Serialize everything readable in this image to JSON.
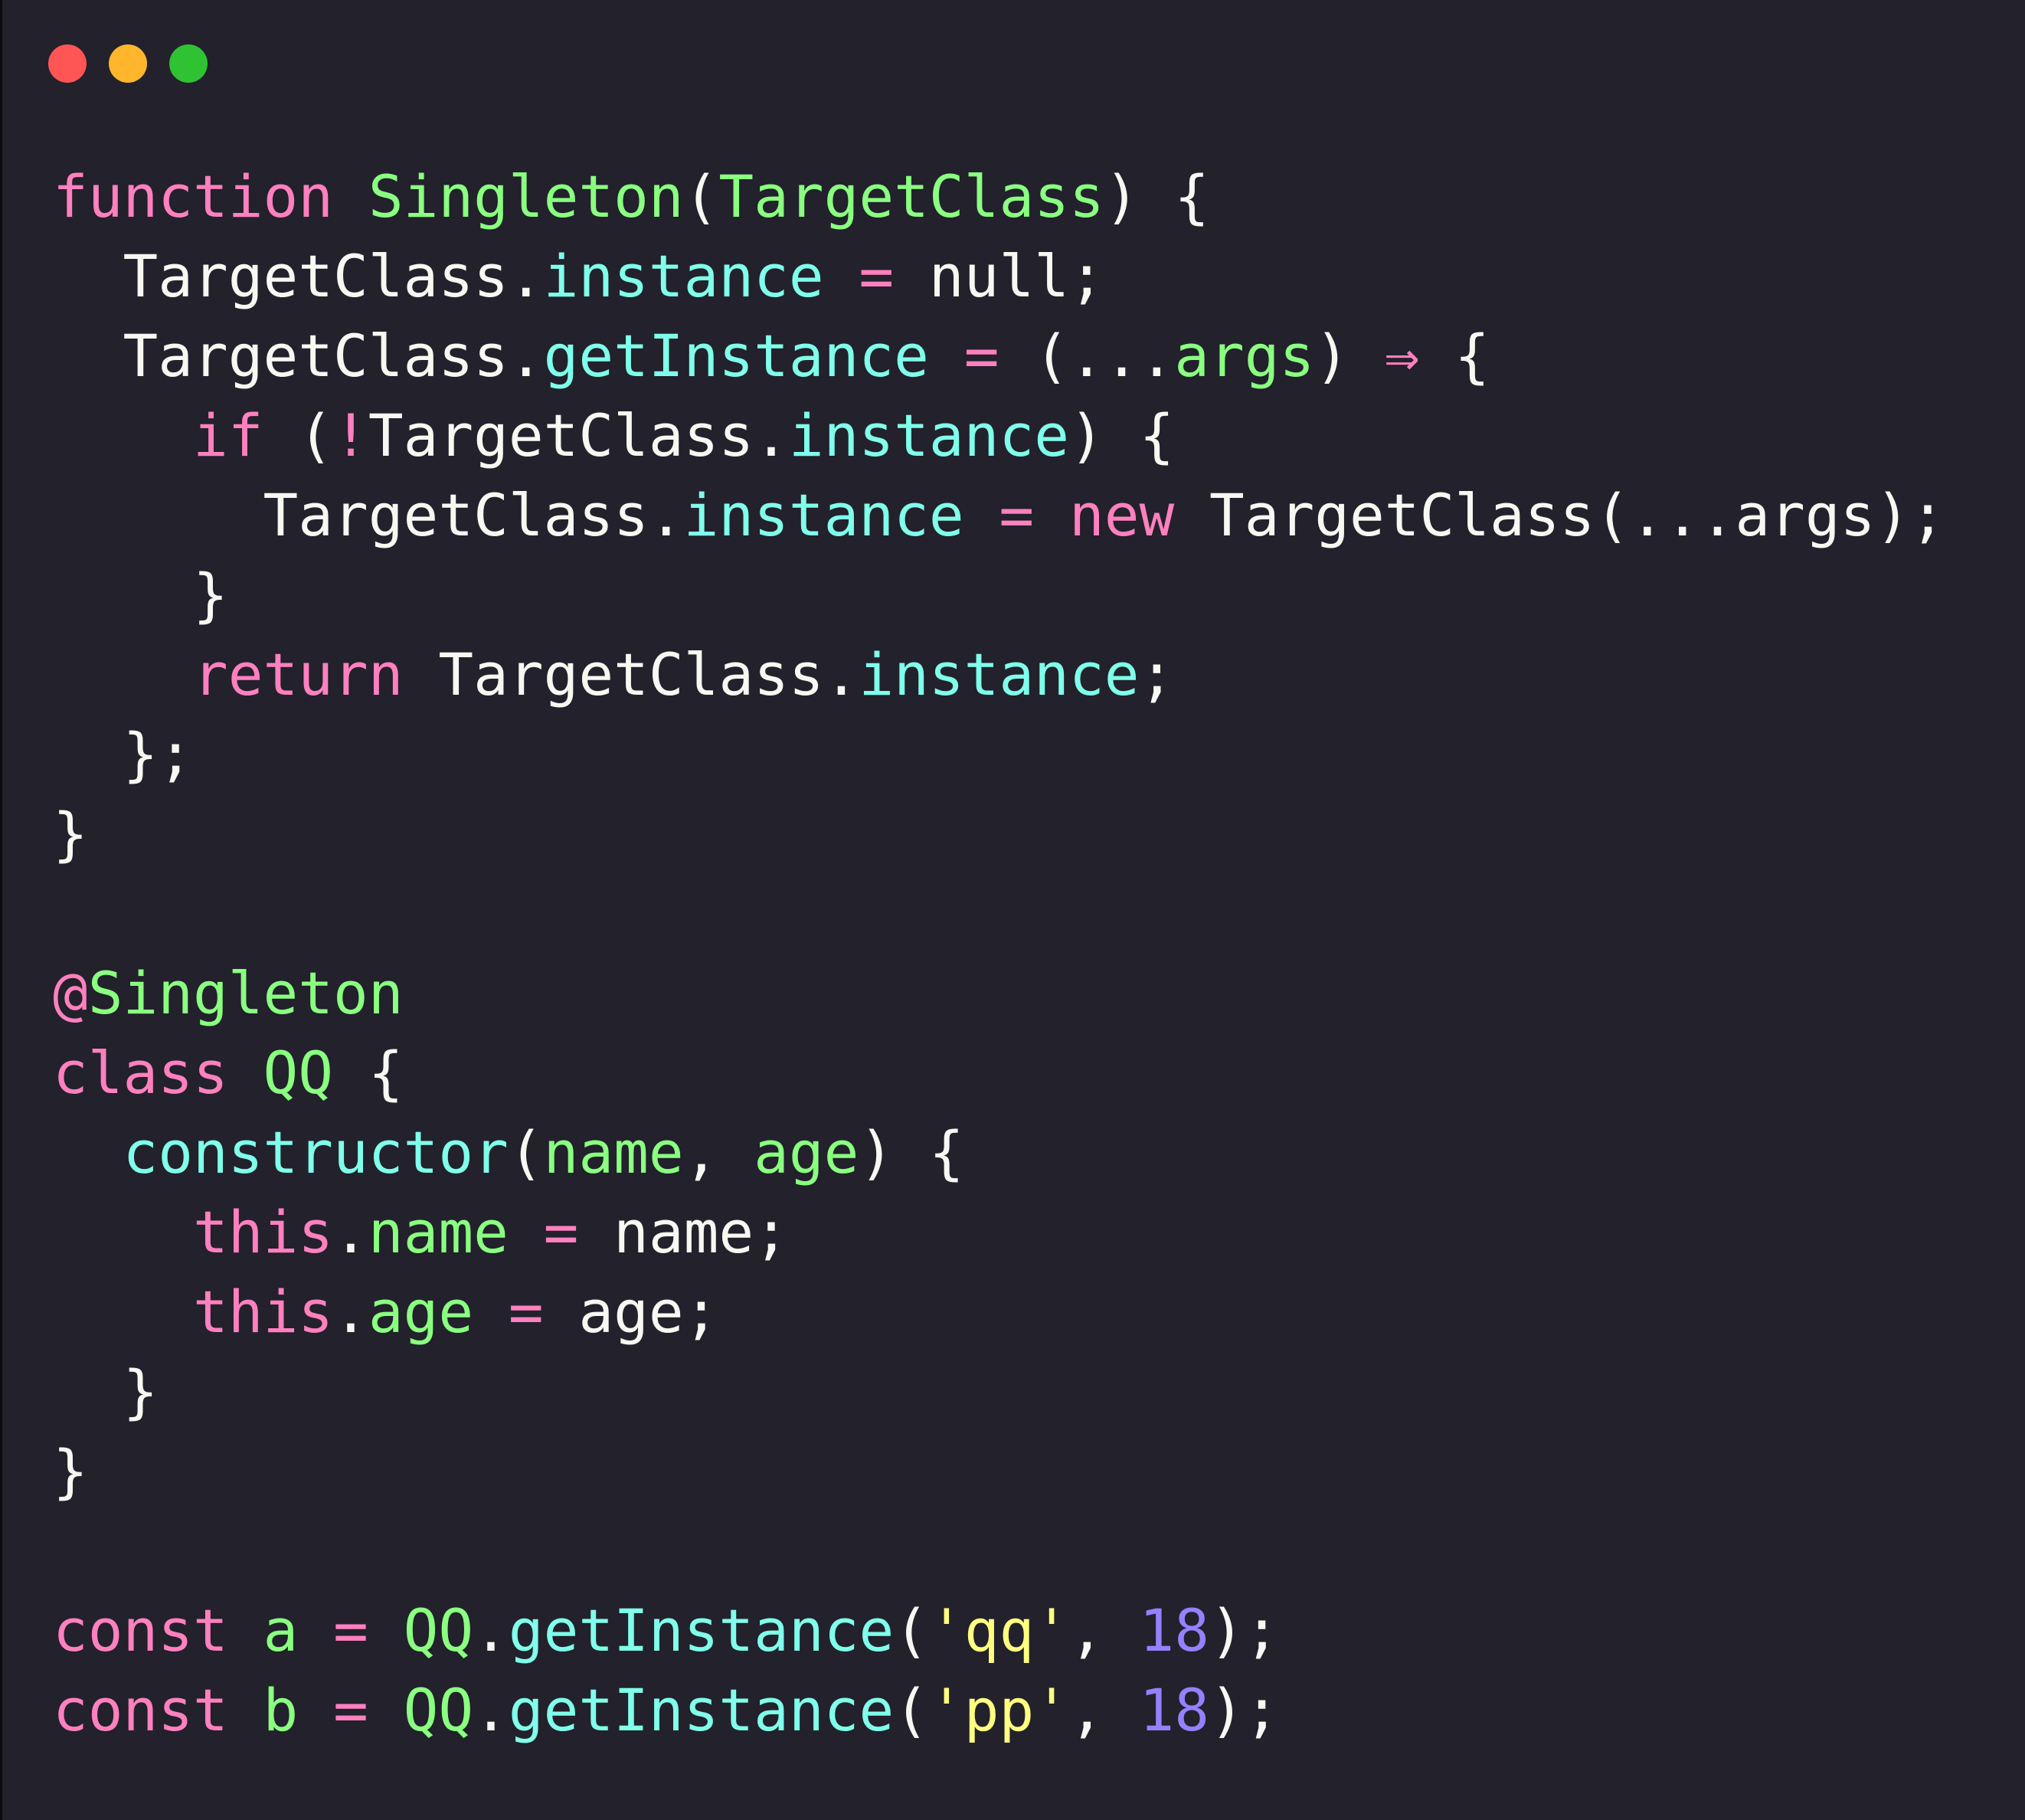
{
  "window": {
    "traffic_lights": [
      "close",
      "minimize",
      "zoom"
    ],
    "colors": {
      "background": "#22212c",
      "close": "#ff5555",
      "minimize": "#ffb62c",
      "zoom": "#2fc233"
    }
  },
  "theme_colors": {
    "keyword": "#ff80bf",
    "function": "#8aff80",
    "property": "#80ffea",
    "string": "#ffff80",
    "number": "#9580ff",
    "plain": "#f8f8f2"
  },
  "code": {
    "language": "javascript",
    "lines": [
      [
        [
          "kw",
          "function"
        ],
        [
          "pl",
          " "
        ],
        [
          "fn",
          "Singleton"
        ],
        [
          "pl",
          "("
        ],
        [
          "fn",
          "TargetClass"
        ],
        [
          "pl",
          ") {"
        ]
      ],
      [
        [
          "pl",
          "  TargetClass."
        ],
        [
          "pr",
          "instance"
        ],
        [
          "pl",
          " "
        ],
        [
          "kw",
          "="
        ],
        [
          "pl",
          " null;"
        ]
      ],
      [
        [
          "pl",
          "  TargetClass."
        ],
        [
          "pr",
          "getInstance"
        ],
        [
          "pl",
          " "
        ],
        [
          "kw",
          "="
        ],
        [
          "pl",
          " (..."
        ],
        [
          "fn",
          "args"
        ],
        [
          "pl",
          ") "
        ],
        [
          "kw",
          "⇒"
        ],
        [
          "pl",
          " {"
        ]
      ],
      [
        [
          "pl",
          "    "
        ],
        [
          "kw",
          "if"
        ],
        [
          "pl",
          " ("
        ],
        [
          "kw",
          "!"
        ],
        [
          "pl",
          "TargetClass."
        ],
        [
          "pr",
          "instance"
        ],
        [
          "pl",
          ") {"
        ]
      ],
      [
        [
          "pl",
          "      TargetClass."
        ],
        [
          "pr",
          "instance"
        ],
        [
          "pl",
          " "
        ],
        [
          "kw",
          "="
        ],
        [
          "pl",
          " "
        ],
        [
          "kw",
          "new"
        ],
        [
          "pl",
          " TargetClass(...args);"
        ]
      ],
      [
        [
          "pl",
          "    }"
        ]
      ],
      [
        [
          "pl",
          "    "
        ],
        [
          "kw",
          "return"
        ],
        [
          "pl",
          " TargetClass."
        ],
        [
          "pr",
          "instance"
        ],
        [
          "pl",
          ";"
        ]
      ],
      [
        [
          "pl",
          "  };"
        ]
      ],
      [
        [
          "pl",
          "}"
        ]
      ],
      [
        [
          "pl",
          ""
        ]
      ],
      [
        [
          "kw",
          "@"
        ],
        [
          "fn",
          "Singleton"
        ]
      ],
      [
        [
          "kw",
          "class"
        ],
        [
          "pl",
          " "
        ],
        [
          "fn",
          "QQ"
        ],
        [
          "pl",
          " {"
        ]
      ],
      [
        [
          "pl",
          "  "
        ],
        [
          "pr",
          "constructor"
        ],
        [
          "pl",
          "("
        ],
        [
          "fn",
          "name"
        ],
        [
          "pl",
          ", "
        ],
        [
          "fn",
          "age"
        ],
        [
          "pl",
          ") {"
        ]
      ],
      [
        [
          "pl",
          "    "
        ],
        [
          "kw",
          "this"
        ],
        [
          "pl",
          "."
        ],
        [
          "fn",
          "name"
        ],
        [
          "pl",
          " "
        ],
        [
          "kw",
          "="
        ],
        [
          "pl",
          " name;"
        ]
      ],
      [
        [
          "pl",
          "    "
        ],
        [
          "kw",
          "this"
        ],
        [
          "pl",
          "."
        ],
        [
          "fn",
          "age"
        ],
        [
          "pl",
          " "
        ],
        [
          "kw",
          "="
        ],
        [
          "pl",
          " age;"
        ]
      ],
      [
        [
          "pl",
          "  }"
        ]
      ],
      [
        [
          "pl",
          "}"
        ]
      ],
      [
        [
          "pl",
          ""
        ]
      ],
      [
        [
          "kw",
          "const"
        ],
        [
          "pl",
          " "
        ],
        [
          "fn",
          "a"
        ],
        [
          "pl",
          " "
        ],
        [
          "kw",
          "="
        ],
        [
          "pl",
          " "
        ],
        [
          "fn",
          "QQ"
        ],
        [
          "pl",
          "."
        ],
        [
          "pr",
          "getInstance"
        ],
        [
          "pl",
          "("
        ],
        [
          "st",
          "'qq'"
        ],
        [
          "pl",
          ", "
        ],
        [
          "nm",
          "18"
        ],
        [
          "pl",
          ");"
        ]
      ],
      [
        [
          "kw",
          "const"
        ],
        [
          "pl",
          " "
        ],
        [
          "fn",
          "b"
        ],
        [
          "pl",
          " "
        ],
        [
          "kw",
          "="
        ],
        [
          "pl",
          " "
        ],
        [
          "fn",
          "QQ"
        ],
        [
          "pl",
          "."
        ],
        [
          "pr",
          "getInstance"
        ],
        [
          "pl",
          "("
        ],
        [
          "st",
          "'pp'"
        ],
        [
          "pl",
          ", "
        ],
        [
          "nm",
          "18"
        ],
        [
          "pl",
          ");"
        ]
      ]
    ]
  }
}
